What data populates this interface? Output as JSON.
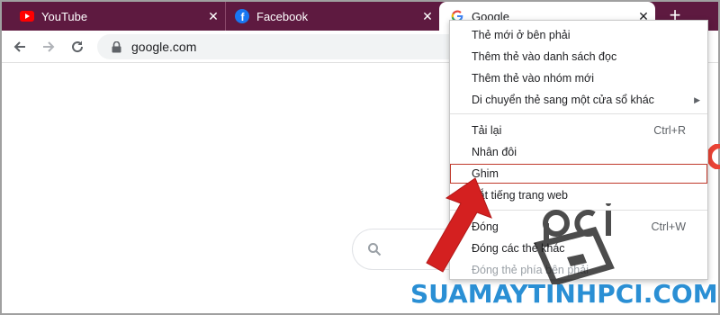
{
  "tabs": [
    {
      "label": "YouTube",
      "icon": "youtube-icon",
      "close": "✕"
    },
    {
      "label": "Facebook",
      "icon": "facebook-icon",
      "close": "✕"
    },
    {
      "label": "Google",
      "icon": "google-icon",
      "close": "✕"
    }
  ],
  "new_tab": "+",
  "toolbar": {
    "url": "google.com"
  },
  "context_menu": {
    "items": [
      {
        "label": "Thẻ mới ở bên phải"
      },
      {
        "label": "Thêm thẻ vào danh sách đọc"
      },
      {
        "label": "Thêm thẻ vào nhóm mới"
      },
      {
        "label": "Di chuyển thẻ sang một cửa sổ khác"
      },
      {
        "label": "Tải lại",
        "shortcut": "Ctrl+R"
      },
      {
        "label": "Nhân đôi"
      },
      {
        "label": "Ghim"
      },
      {
        "label": "Tắt tiếng trang web"
      },
      {
        "label": "Đóng",
        "shortcut": "Ctrl+W"
      },
      {
        "label": "Đóng các thẻ khác"
      },
      {
        "label": "Đóng thẻ phía bên phải"
      }
    ],
    "highlighted": "Ghim"
  },
  "watermark": {
    "logo_text": "pci",
    "text": "SUAMAYTINHPCI.COM"
  },
  "colors": {
    "tab_strip": "#5e1a40",
    "highlight_border": "#c0392b",
    "arrow": "#d42020",
    "watermark": "#2a8fd4"
  }
}
